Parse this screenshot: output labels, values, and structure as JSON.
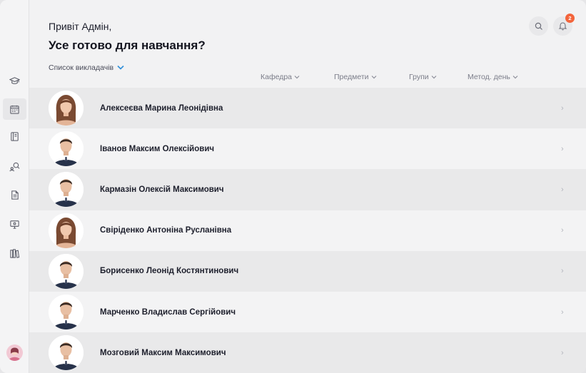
{
  "header": {
    "greeting": "Привіт Адмін,",
    "title": "Усе готово для навчання?",
    "list_selector": "Список викладачів",
    "notification_count": "2"
  },
  "columns": [
    {
      "label": "Кафедра"
    },
    {
      "label": "Предмети"
    },
    {
      "label": "Групи"
    },
    {
      "label": "Метод. день"
    }
  ],
  "teachers": [
    {
      "name": "Алексеєва Марина Леонідівна",
      "gender": "female"
    },
    {
      "name": "Іванов Максим Олексійович",
      "gender": "male"
    },
    {
      "name": "Кармазін Олексій Максимович",
      "gender": "male"
    },
    {
      "name": "Свіріденко Антоніна Русланівна",
      "gender": "female"
    },
    {
      "name": "Борисенко Леонід Костянтинович",
      "gender": "male"
    },
    {
      "name": "Марченко Владислав Сергійович",
      "gender": "male"
    },
    {
      "name": "Мозговий Максим Максимович",
      "gender": "male"
    }
  ],
  "sidebar_icons": [
    "graduation-cap-icon",
    "calendar-icon",
    "book-icon",
    "search-people-icon",
    "document-icon",
    "monitor-icon",
    "library-icon"
  ],
  "colors": {
    "accent": "#2f8ed8",
    "badge": "#f3643b",
    "row_dark": "#e9e9ea",
    "row_light": "#f3f3f4"
  }
}
